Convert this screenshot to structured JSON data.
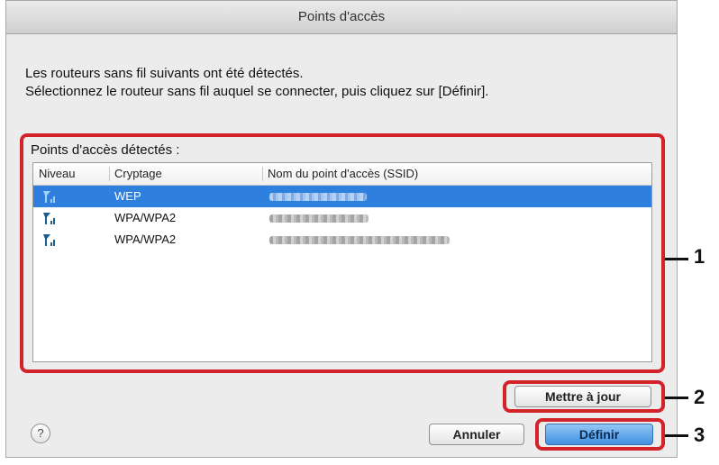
{
  "window": {
    "title": "Points d'accès"
  },
  "intro": {
    "line1": "Les routeurs sans fil suivants ont été détectés.",
    "line2": "Sélectionnez le routeur sans fil auquel se connecter, puis cliquez sur [Définir]."
  },
  "access_points": {
    "group_label": "Points d'accès détectés :",
    "columns": [
      "Niveau",
      "Cryptage",
      "Nom du point d'accès (SSID)"
    ],
    "rows": [
      {
        "signal_icon": "wifi-signal-icon",
        "encryption": "WEP",
        "selected": true
      },
      {
        "signal_icon": "wifi-signal-icon",
        "encryption": "WPA/WPA2",
        "selected": false
      },
      {
        "signal_icon": "wifi-signal-icon",
        "encryption": "WPA/WPA2",
        "selected": false
      }
    ]
  },
  "buttons": {
    "update": "Mettre à jour",
    "cancel": "Annuler",
    "define": "Définir",
    "help": "?"
  },
  "callouts": [
    "1",
    "2",
    "3"
  ],
  "colors": {
    "highlight": "#d3232a",
    "selection": "#2f7fde"
  }
}
